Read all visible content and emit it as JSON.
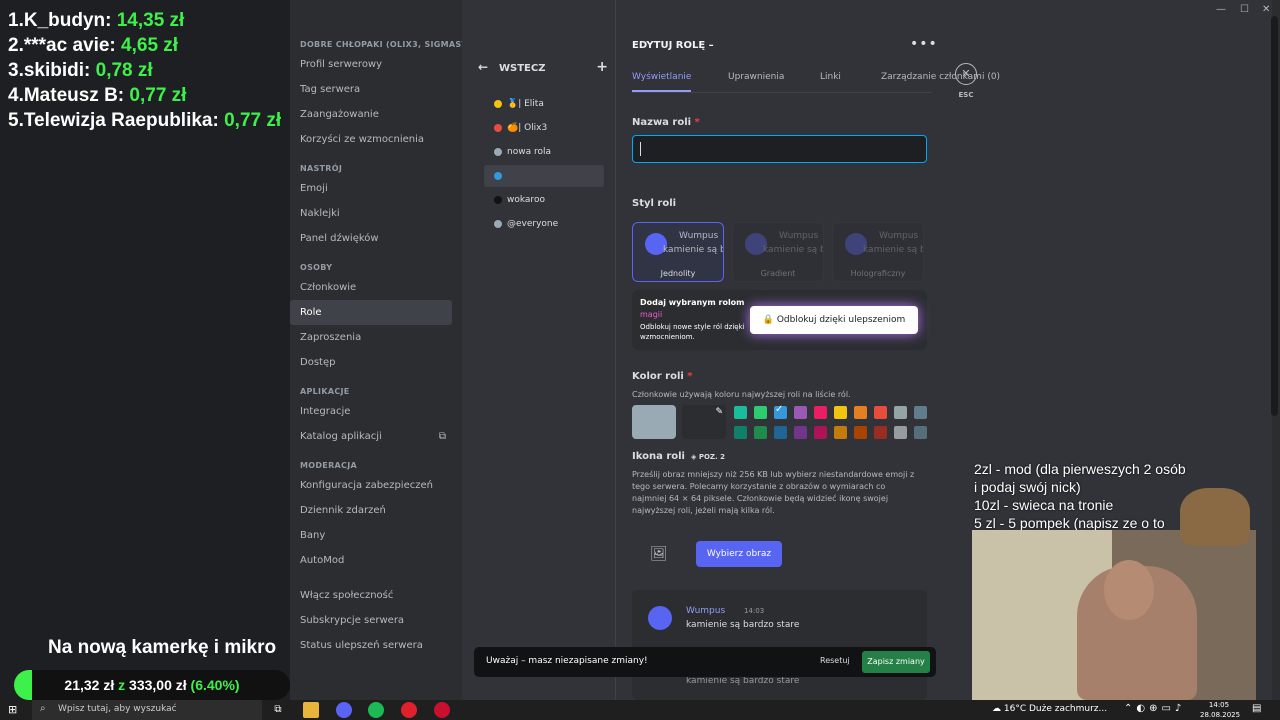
{
  "overlay": {
    "donors": [
      {
        "label": "1.K_budyn: ",
        "amount": "14,35 zł"
      },
      {
        "label": "2.***ac avie: ",
        "amount": "4,65 zł"
      },
      {
        "label": "3.skibidi: ",
        "amount": "0,78 zł"
      },
      {
        "label": "4.Mateusz B: ",
        "amount": "0,77 zł"
      },
      {
        "label": "5.Telewizja Raepublika: ",
        "amount": "0,77 zł"
      }
    ],
    "goal_title": "Na nową kamerkę i mikro",
    "goal_current": "21,32 zł",
    "goal_sep": " z ",
    "goal_target": "333,00 zł",
    "goal_percent_text": " (6.40%)",
    "goal_fraction": 0.064,
    "cam_text_lines": [
      "2zl - mod (dla pierweszych 2 osób",
      "i podaj swój nick)",
      "10zl - swieca na tronie",
      "5 zl - 5 pompek (napisz ze o to"
    ]
  },
  "sidebar": {
    "server_header": "DOBRE CHŁOPAKI (OLIX3, SIGMAST...",
    "server_items": [
      "Profil serwerowy",
      "Tag serwera",
      "Zaangażowanie",
      "Korzyści ze wzmocnienia"
    ],
    "mood_header": "NASTRÓJ",
    "mood_items": [
      "Emoji",
      "Naklejki",
      "Panel dźwięków"
    ],
    "people_header": "OSOBY",
    "people_items": [
      "Członkowie",
      "Role",
      "Zaproszenia",
      "Dostęp"
    ],
    "apps_header": "APLIKACJE",
    "apps_items": [
      "Integracje",
      "Katalog aplikacji"
    ],
    "mod_header": "MODERACJA",
    "mod_items": [
      "Konfiguracja zabezpieczeń",
      "Dziennik zdarzeń",
      "Bany",
      "AutoMod"
    ],
    "other_items": [
      "Włącz społeczność",
      "Subskrypcje serwera",
      "Status ulepszeń serwera"
    ]
  },
  "roles": {
    "back_label": "WSTECZ",
    "items": [
      {
        "name": "🥇| Elita",
        "color": "#f1c40f"
      },
      {
        "name": "🍊| Olix3",
        "color": "#e74c3c"
      },
      {
        "name": "nowa rola",
        "color": "#99aab5"
      },
      {
        "name": "",
        "color": "#3498db"
      },
      {
        "name": "wokaroo",
        "color": "#111214"
      },
      {
        "name": "@everyone",
        "color": "#99aab5"
      }
    ]
  },
  "editor": {
    "title": "EDYTUJ ROLĘ –",
    "tabs": [
      "Wyświetlanie",
      "Uprawnienia",
      "Linki",
      "Zarządzanie członkami (0)"
    ],
    "esc_label": "ESC",
    "name_label": "Nazwa roli",
    "name_value": "",
    "style_label": "Styl roli",
    "style_nick": "Wumpus",
    "style_msg": "kamienie są ba",
    "styles": [
      "Jednolity",
      "Gradient",
      "Holograficzny"
    ],
    "upsell_title": "Dodaj wybranym rolom",
    "upsell_magic": "magii",
    "upsell_desc": "Odblokuj nowe style ról dzięki wzmocnieniom.",
    "upsell_button": "Odblokuj dzięki ulepszeniom",
    "color_label": "Kolor roli",
    "color_desc": "Członkowie używają koloru najwyższej roli na liście ról.",
    "icon_label": "Ikona roli",
    "icon_level": "POZ. 2",
    "icon_desc": "Prześlij obraz mniejszy niż 256 KB lub wybierz niestandardowe emoji z tego serwera. Polecamy korzystanie z obrazów o wymiarach co najmniej 64 × 64 piksele. Członkowie będą widzieć ikonę swojej najwyższej roli, jeżeli mają kilka ról.",
    "choose_button": "Wybierz obraz",
    "preview_user": "Wumpus",
    "preview_time": "14:03",
    "preview_text": "kamienie są bardzo stare"
  },
  "colors": {
    "main": "#99aab5",
    "row1": [
      "#1abc9c",
      "#2ecc71",
      "#3498db",
      "#9b59b6",
      "#e91e63",
      "#f1c40f",
      "#e67e22",
      "#e74c3c",
      "#95a5a6",
      "#607d8b"
    ],
    "row2": [
      "#11806a",
      "#1f8b4c",
      "#206694",
      "#71368a",
      "#ad1457",
      "#c27c0e",
      "#a84300",
      "#992d22",
      "#979c9f",
      "#546e7a"
    ]
  },
  "unsaved": {
    "warning": "Uważaj – masz niezapisane zmiany!",
    "reset": "Resetuj",
    "save": "Zapisz zmiany"
  },
  "taskbar": {
    "search_placeholder": "Wpisz tutaj, aby wyszukać",
    "weather": "16°C  Duże zachmurz...",
    "time": "14:05",
    "date": "28.08.2025"
  }
}
